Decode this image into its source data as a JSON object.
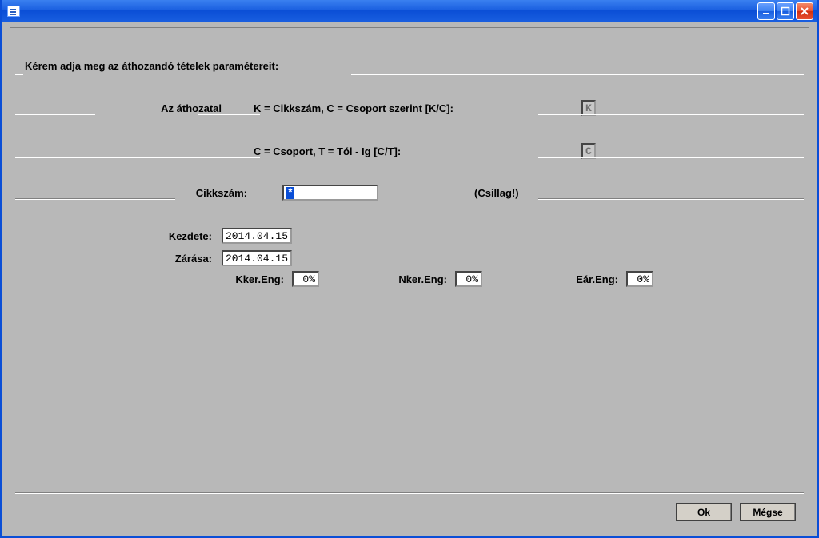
{
  "window": {
    "title": ""
  },
  "heading": "Kérem adja meg az áthozandó  tételek paramétereit:",
  "row_kc": {
    "left_label": "Az áthozatal",
    "desc": "K = Cikkszám,   C = Csoport szerint [K/C]:",
    "value": "K"
  },
  "row_ct": {
    "desc": "C = Csoport,    T = Tól - Ig [C/T]:",
    "value": "C"
  },
  "row_cikk": {
    "label": "Cikkszám:",
    "value": "*",
    "hint": "(Csillag!)"
  },
  "dates": {
    "start_label": "Kezdete:",
    "start_value": "2014.04.15",
    "end_label": "Zárása:",
    "end_value": "2014.04.15"
  },
  "eng": {
    "kker_label": "Kker.Eng:",
    "kker_value": "0%",
    "nker_label": "Nker.Eng:",
    "nker_value": "0%",
    "ear_label": "Eár.Eng:",
    "ear_value": "0%"
  },
  "buttons": {
    "ok": "Ok",
    "cancel": "Mégse"
  }
}
